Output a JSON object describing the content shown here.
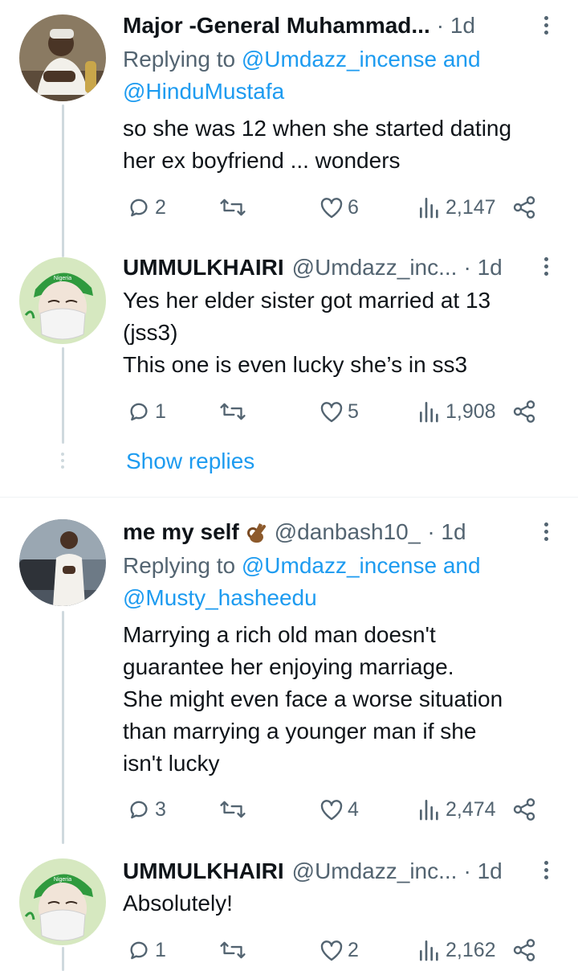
{
  "tweets": [
    {
      "name": "Major -General Muhammad...",
      "handle": "",
      "time": "· 1d",
      "replying_prefix": "Replying to ",
      "replying_to_1": "@Umdazz_incense",
      "replying_and": " and",
      "replying_to_2": "@HinduMustafa",
      "lines": [
        "so she was 12 when she started dating",
        "her ex boyfriend ... wonders"
      ],
      "replies": "2",
      "retweets": "",
      "likes": "6",
      "views": "2,147"
    },
    {
      "name": "UMMULKHAIRI",
      "handle": "@Umdazz_inc...",
      "time": "· 1d",
      "lines": [
        "Yes her elder sister got married at 13",
        "(jss3)",
        "This one is even lucky she’s in ss3"
      ],
      "replies": "1",
      "retweets": "",
      "likes": "5",
      "views": "1,908"
    },
    {
      "name": "me my self",
      "handle": "@danbash10_",
      "time": "· 1d",
      "emoji_icon": "ok-hand-emoji-icon",
      "replying_prefix": "Replying to ",
      "replying_to_1": "@Umdazz_incense",
      "replying_and": " and",
      "replying_to_2": "@Musty_hasheedu",
      "lines": [
        "Marrying a rich old man doesn't",
        "guarantee her enjoying marriage.",
        "She might even face a worse situation",
        "than marrying a younger man if she",
        "isn't lucky"
      ],
      "replies": "3",
      "retweets": "",
      "likes": "4",
      "views": "2,474"
    },
    {
      "name": "UMMULKHAIRI",
      "handle": "@Umdazz_inc...",
      "time": "· 1d",
      "lines": [
        "Absolutely!"
      ],
      "replies": "1",
      "retweets": "",
      "likes": "2",
      "views": "2,162"
    }
  ],
  "show_replies": "Show replies",
  "colors": {
    "accent": "#1d9bf0",
    "secondary_text": "#536471",
    "thread_line": "#cfd9de"
  }
}
